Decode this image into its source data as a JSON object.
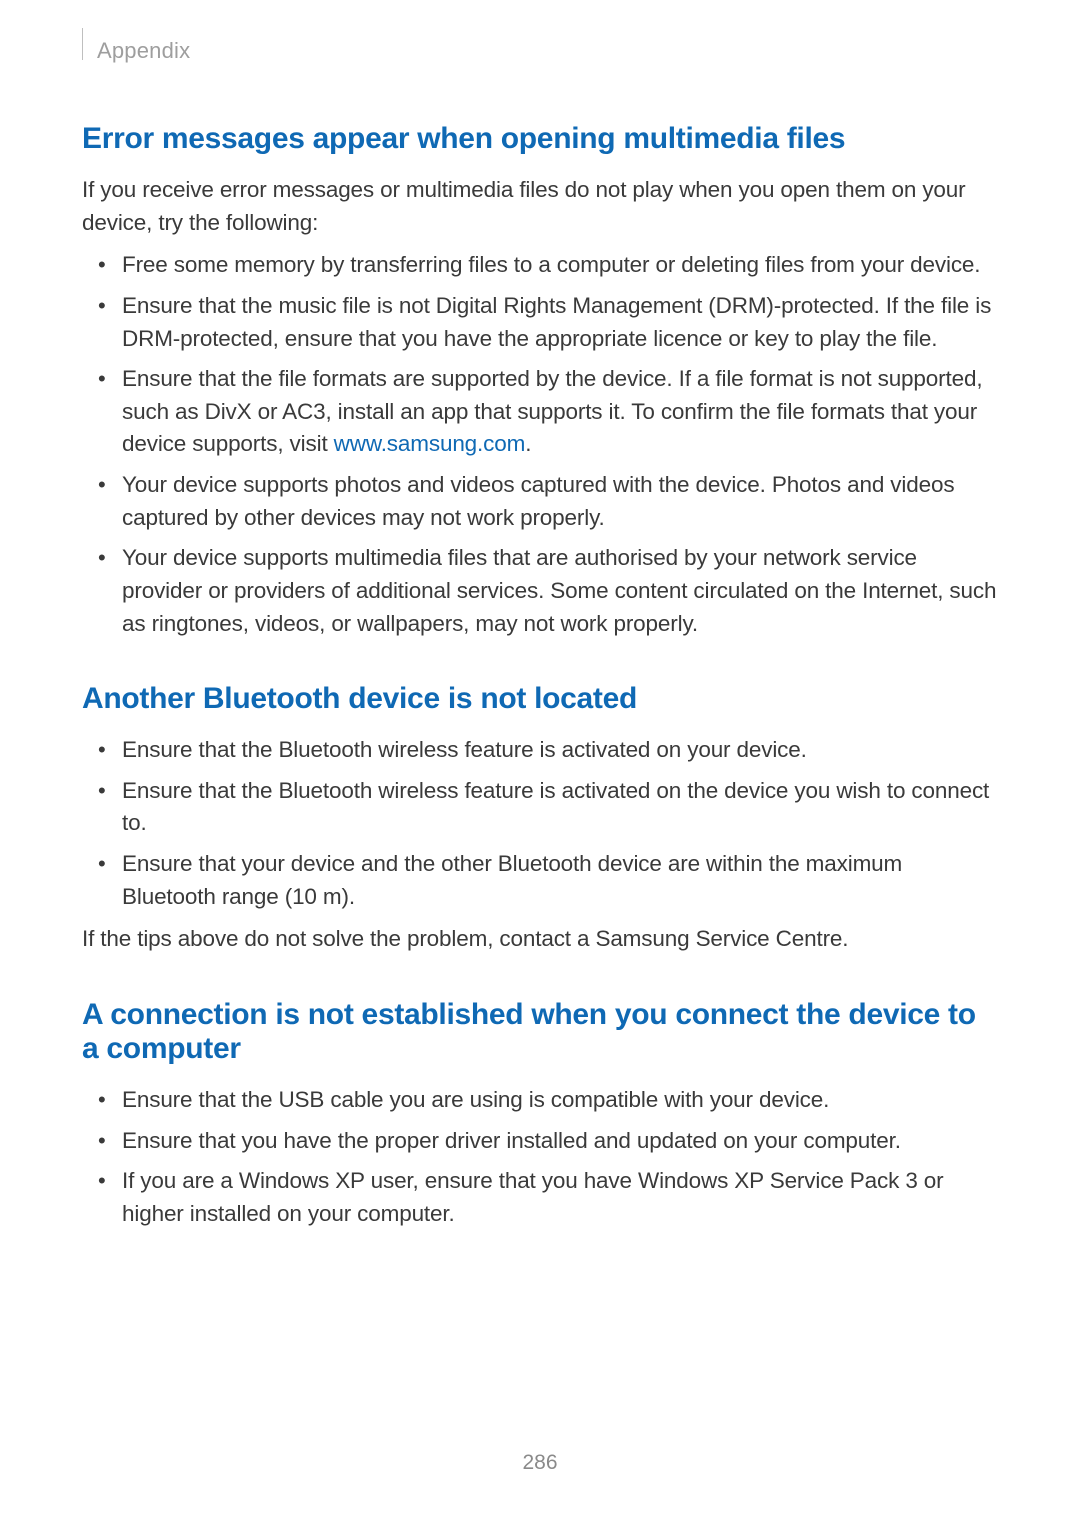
{
  "header": {
    "section": "Appendix"
  },
  "page_number": "286",
  "sections": [
    {
      "heading": "Error messages appear when opening multimedia files",
      "intro": "If you receive error messages or multimedia files do not play when you open them on your device, try the following:",
      "bullets": [
        {
          "text": "Free some memory by transferring files to a computer or deleting files from your device."
        },
        {
          "text": "Ensure that the music file is not Digital Rights Management (DRM)-protected. If the file is DRM-protected, ensure that you have the appropriate licence or key to play the file."
        },
        {
          "text_before": "Ensure that the file formats are supported by the device. If a file format is not supported, such as DivX or AC3, install an app that supports it. To confirm the file formats that your device supports, visit ",
          "link": "www.samsung.com",
          "text_after": "."
        },
        {
          "text": "Your device supports photos and videos captured with the device. Photos and videos captured by other devices may not work properly."
        },
        {
          "text": "Your device supports multimedia files that are authorised by your network service provider or providers of additional services. Some content circulated on the Internet, such as ringtones, videos, or wallpapers, may not work properly."
        }
      ]
    },
    {
      "heading": "Another Bluetooth device is not located",
      "bullets": [
        {
          "text": "Ensure that the Bluetooth wireless feature is activated on your device."
        },
        {
          "text": "Ensure that the Bluetooth wireless feature is activated on the device you wish to connect to."
        },
        {
          "text": "Ensure that your device and the other Bluetooth device are within the maximum Bluetooth range (10 m)."
        }
      ],
      "outro": "If the tips above do not solve the problem, contact a Samsung Service Centre."
    },
    {
      "heading": "A connection is not established when you connect the device to a computer",
      "bullets": [
        {
          "text": "Ensure that the USB cable you are using is compatible with your device."
        },
        {
          "text": "Ensure that you have the proper driver installed and updated on your computer."
        },
        {
          "text": "If you are a Windows XP user, ensure that you have Windows XP Service Pack 3 or higher installed on your computer."
        }
      ]
    }
  ]
}
